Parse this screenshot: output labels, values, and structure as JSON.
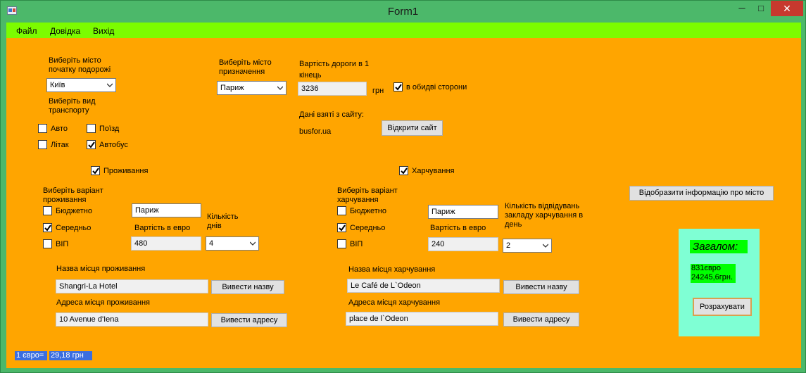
{
  "window": {
    "title": "Form1",
    "controls": {
      "minimize": "─",
      "maximize": "□",
      "close": "✕"
    }
  },
  "menu": [
    "Файл",
    "Довідка",
    "Вихід"
  ],
  "trip": {
    "start_city_label": "Виберіть місто початку подорожі",
    "start_city": "Київ",
    "transport_label": "Виберіть вид транспорту",
    "transport": {
      "auto": "Авто",
      "train": "Поїзд",
      "plane": "Літак",
      "bus": "Автобус"
    },
    "dest_city_label": "Виберіть місто призначення",
    "dest_city": "Париж",
    "cost_label": "Вартість дороги в 1 кінець",
    "cost_value": "3236",
    "cost_unit": "грн",
    "both_ways_label": "в обидві сторони",
    "source_label": "Дані взяті з сайту:",
    "source_site": "busfor.ua",
    "open_site_button": "Відкрити сайт"
  },
  "accommodation": {
    "toggle_label": "Проживання",
    "variant_label": "Виберіть варіант проживання",
    "options": {
      "budget": "Бюджетно",
      "middle": "Середньо",
      "vip": "ВІП"
    },
    "city_value": "Париж",
    "price_label": "Вартість в евро",
    "price_value": "480",
    "days_label": "Кількість днів",
    "days_value": "4",
    "name_label": "Назва місця проживання",
    "name_value": "Shangri-La Hotel",
    "name_button": "Вивести назву",
    "address_label": "Адреса місця проживання",
    "address_value": "10 Avenue d'Iena",
    "address_button": "Вивести адресу"
  },
  "food": {
    "toggle_label": "Харчування",
    "variant_label": "Виберіть варіант харчування",
    "options": {
      "budget": "Бюджетно",
      "middle": "Середньо",
      "vip": "ВІП"
    },
    "city_value": "Париж",
    "price_label": "Вартість в евро",
    "price_value": "240",
    "visits_label": "Кількість відвідувань закладу харчування в день",
    "visits_value": "2",
    "name_label": "Назва місця харчування",
    "name_value": "Le Café de L`Odeon",
    "name_button": "Вивести назву",
    "address_label": "Адреса місця харчування",
    "address_value": "place de l`Odeon",
    "address_button": "Вивести адресу"
  },
  "city_info_button": "Відобразити інформацію про місто",
  "summary": {
    "header": "Загалом:",
    "line1": "831євро",
    "line2": "24245,6грн.",
    "calc_button": "Розрахувати"
  },
  "exchange": {
    "label": "1 євро=",
    "value": "29,18  грн"
  },
  "colors": {
    "client_bg": "#ffa500",
    "menubar_bg": "#7cfc00",
    "titlebar_bg": "#4cb86a",
    "summary_bg": "#7fffd4",
    "highlight_green": "#00ff00",
    "rate_blue": "#3a6ee0"
  }
}
